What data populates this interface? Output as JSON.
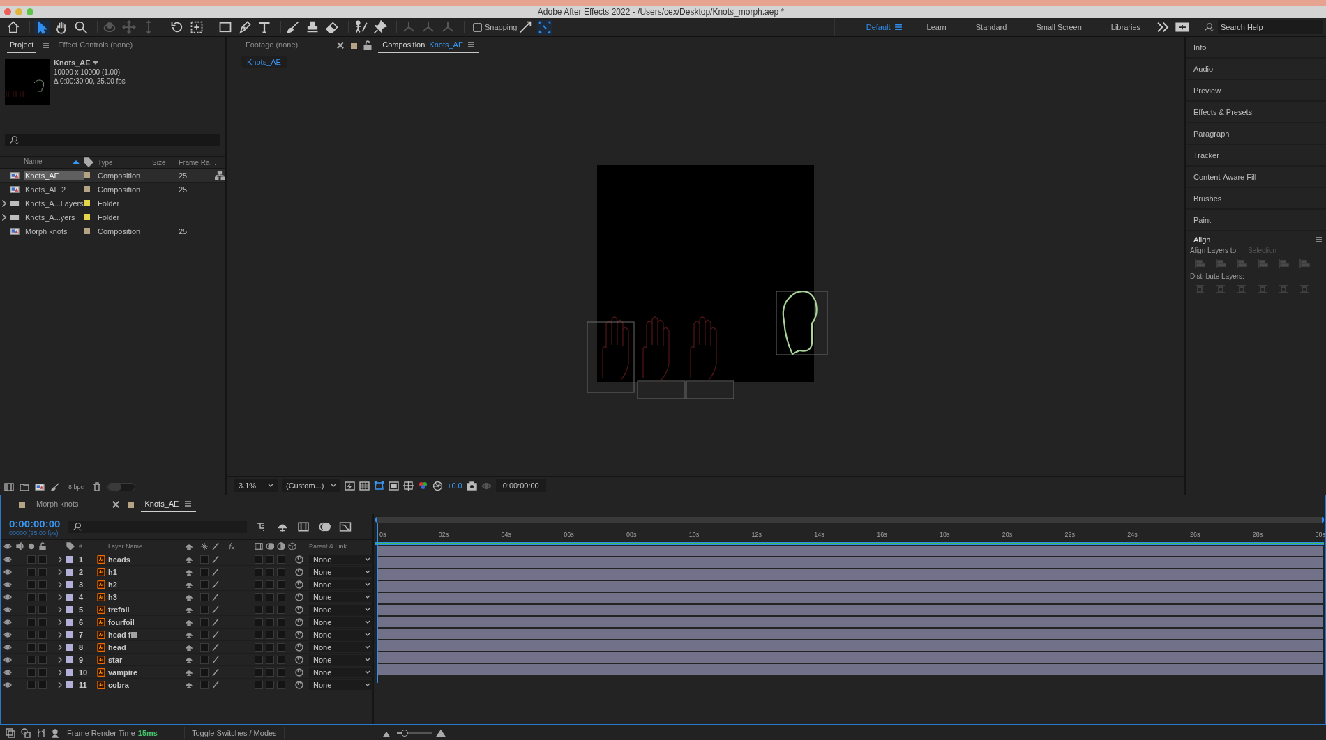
{
  "title_bar": {
    "title": "Adobe After Effects 2022 - /Users/cex/Desktop/Knots_morph.aep *"
  },
  "toolbar": {
    "tools": [
      {
        "kind": "home",
        "selected": false,
        "disabled": false
      },
      {
        "kind": "selection",
        "selected": true,
        "disabled": false
      },
      {
        "kind": "hand",
        "selected": false,
        "disabled": false
      },
      {
        "kind": "zoom",
        "selected": false,
        "disabled": false
      },
      {
        "kind": "orbit",
        "selected": false,
        "disabled": true
      },
      {
        "kind": "pan",
        "selected": false,
        "disabled": true
      },
      {
        "kind": "dolly",
        "selected": false,
        "disabled": true
      },
      {
        "kind": "rotate",
        "selected": false,
        "disabled": false
      },
      {
        "kind": "anchor",
        "selected": false,
        "disabled": false
      },
      {
        "kind": "rectangle",
        "selected": false,
        "disabled": false
      },
      {
        "kind": "pen",
        "selected": false,
        "disabled": false
      },
      {
        "kind": "type",
        "selected": false,
        "disabled": false
      },
      {
        "kind": "brush",
        "selected": false,
        "disabled": false
      },
      {
        "kind": "stamp",
        "selected": false,
        "disabled": false
      },
      {
        "kind": "eraser",
        "selected": false,
        "disabled": false
      },
      {
        "kind": "roto",
        "selected": false,
        "disabled": false
      },
      {
        "kind": "pin",
        "selected": false,
        "disabled": false
      }
    ],
    "snapping": {
      "label": "Snapping",
      "checked": false
    },
    "workspaces": [
      {
        "label": "Default",
        "selected": true
      },
      {
        "label": "Learn",
        "selected": false
      },
      {
        "label": "Standard",
        "selected": false
      },
      {
        "label": "Small Screen",
        "selected": false
      },
      {
        "label": "Libraries",
        "selected": false
      }
    ],
    "search_help": {
      "placeholder": "Search Help"
    }
  },
  "project_panel": {
    "tabs": [
      {
        "label": "Project",
        "selected": true
      },
      {
        "label": "Effect Controls (none)",
        "selected": false
      }
    ],
    "preview": {
      "name": "Knots_AE",
      "dimensions": "10000 x 10000 (1.00)",
      "duration": "Δ 0:00:30:00, 25.00 fps"
    },
    "columns": {
      "name": "Name",
      "type": "Type",
      "size": "Size",
      "frame_rate": "Frame Ra…"
    },
    "items": [
      {
        "kind": "composition",
        "name": "Knots_AE",
        "type": "Composition",
        "frame_rate": "25",
        "color": "#b4a385",
        "selected": true
      },
      {
        "kind": "composition",
        "name": "Knots_AE 2",
        "type": "Composition",
        "frame_rate": "25",
        "color": "#b4a385",
        "selected": false
      },
      {
        "kind": "folder",
        "name": "Knots_A...Layers",
        "type": "Folder",
        "color": "#e3d64b",
        "selected": false
      },
      {
        "kind": "folder",
        "name": "Knots_A...yers",
        "type": "Folder",
        "color": "#e3d64b",
        "selected": false
      },
      {
        "kind": "composition",
        "name": "Morph knots",
        "type": "Composition",
        "frame_rate": "25",
        "color": "#b4a385",
        "selected": false
      }
    ],
    "bit_depth": "8 bpc",
    "thumbnail_size": {
      "level": 0.5
    }
  },
  "viewer": {
    "tabs": [
      {
        "kind": "footage",
        "label": "Footage (none)",
        "selected": false
      },
      {
        "kind": "composition",
        "label": "Composition",
        "name": "Knots_AE",
        "selected": true
      }
    ],
    "comp_tab": "Knots_AE",
    "zoom": "3.1%",
    "resolution": "(Custom...)",
    "exposure": "+0.0",
    "timecode": "0:00:00:00"
  },
  "right_panel": {
    "panels": [
      "Info",
      "Audio",
      "Preview",
      "Effects & Presets",
      "Paragraph",
      "Tracker",
      "Content-Aware Fill",
      "Brushes",
      "Paint"
    ],
    "align": {
      "title": "Align",
      "align_to_label": "Align Layers to:",
      "align_to_value": "Selection",
      "distribute_label": "Distribute Layers:"
    }
  },
  "timeline": {
    "tabs": [
      {
        "label": "Morph knots",
        "selected": false
      },
      {
        "label": "Knots_AE",
        "selected": true
      }
    ],
    "current_time": "0:00:00:00",
    "frame_info": "00000 (25.00 fps)",
    "columns": {
      "number": "#",
      "layer_name": "Layer Name",
      "parent": "Parent & Link"
    },
    "layers": [
      {
        "number": "1",
        "name": "heads",
        "parent": "None",
        "visible": true
      },
      {
        "number": "2",
        "name": "h1",
        "parent": "None",
        "visible": true
      },
      {
        "number": "3",
        "name": "h2",
        "parent": "None",
        "visible": true
      },
      {
        "number": "4",
        "name": "h3",
        "parent": "None",
        "visible": true
      },
      {
        "number": "5",
        "name": "trefoil",
        "parent": "None",
        "visible": true
      },
      {
        "number": "6",
        "name": "fourfoil",
        "parent": "None",
        "visible": true
      },
      {
        "number": "7",
        "name": "head fill",
        "parent": "None",
        "visible": true
      },
      {
        "number": "8",
        "name": "head",
        "parent": "None",
        "visible": true
      },
      {
        "number": "9",
        "name": "star",
        "parent": "None",
        "visible": true
      },
      {
        "number": "10",
        "name": "vampire",
        "parent": "None",
        "visible": true
      },
      {
        "number": "11",
        "name": "cobra",
        "parent": "None",
        "visible": true
      }
    ],
    "ruler": [
      "0s",
      "02s",
      "04s",
      "06s",
      "08s",
      "10s",
      "12s",
      "14s",
      "16s",
      "18s",
      "20s",
      "22s",
      "24s",
      "26s",
      "28s",
      "30s"
    ],
    "zoom_slider": {
      "level": 0.22
    },
    "footer": {
      "render_label": "Frame Render Time",
      "render_time": "15ms",
      "toggle_label": "Toggle Switches / Modes"
    }
  }
}
